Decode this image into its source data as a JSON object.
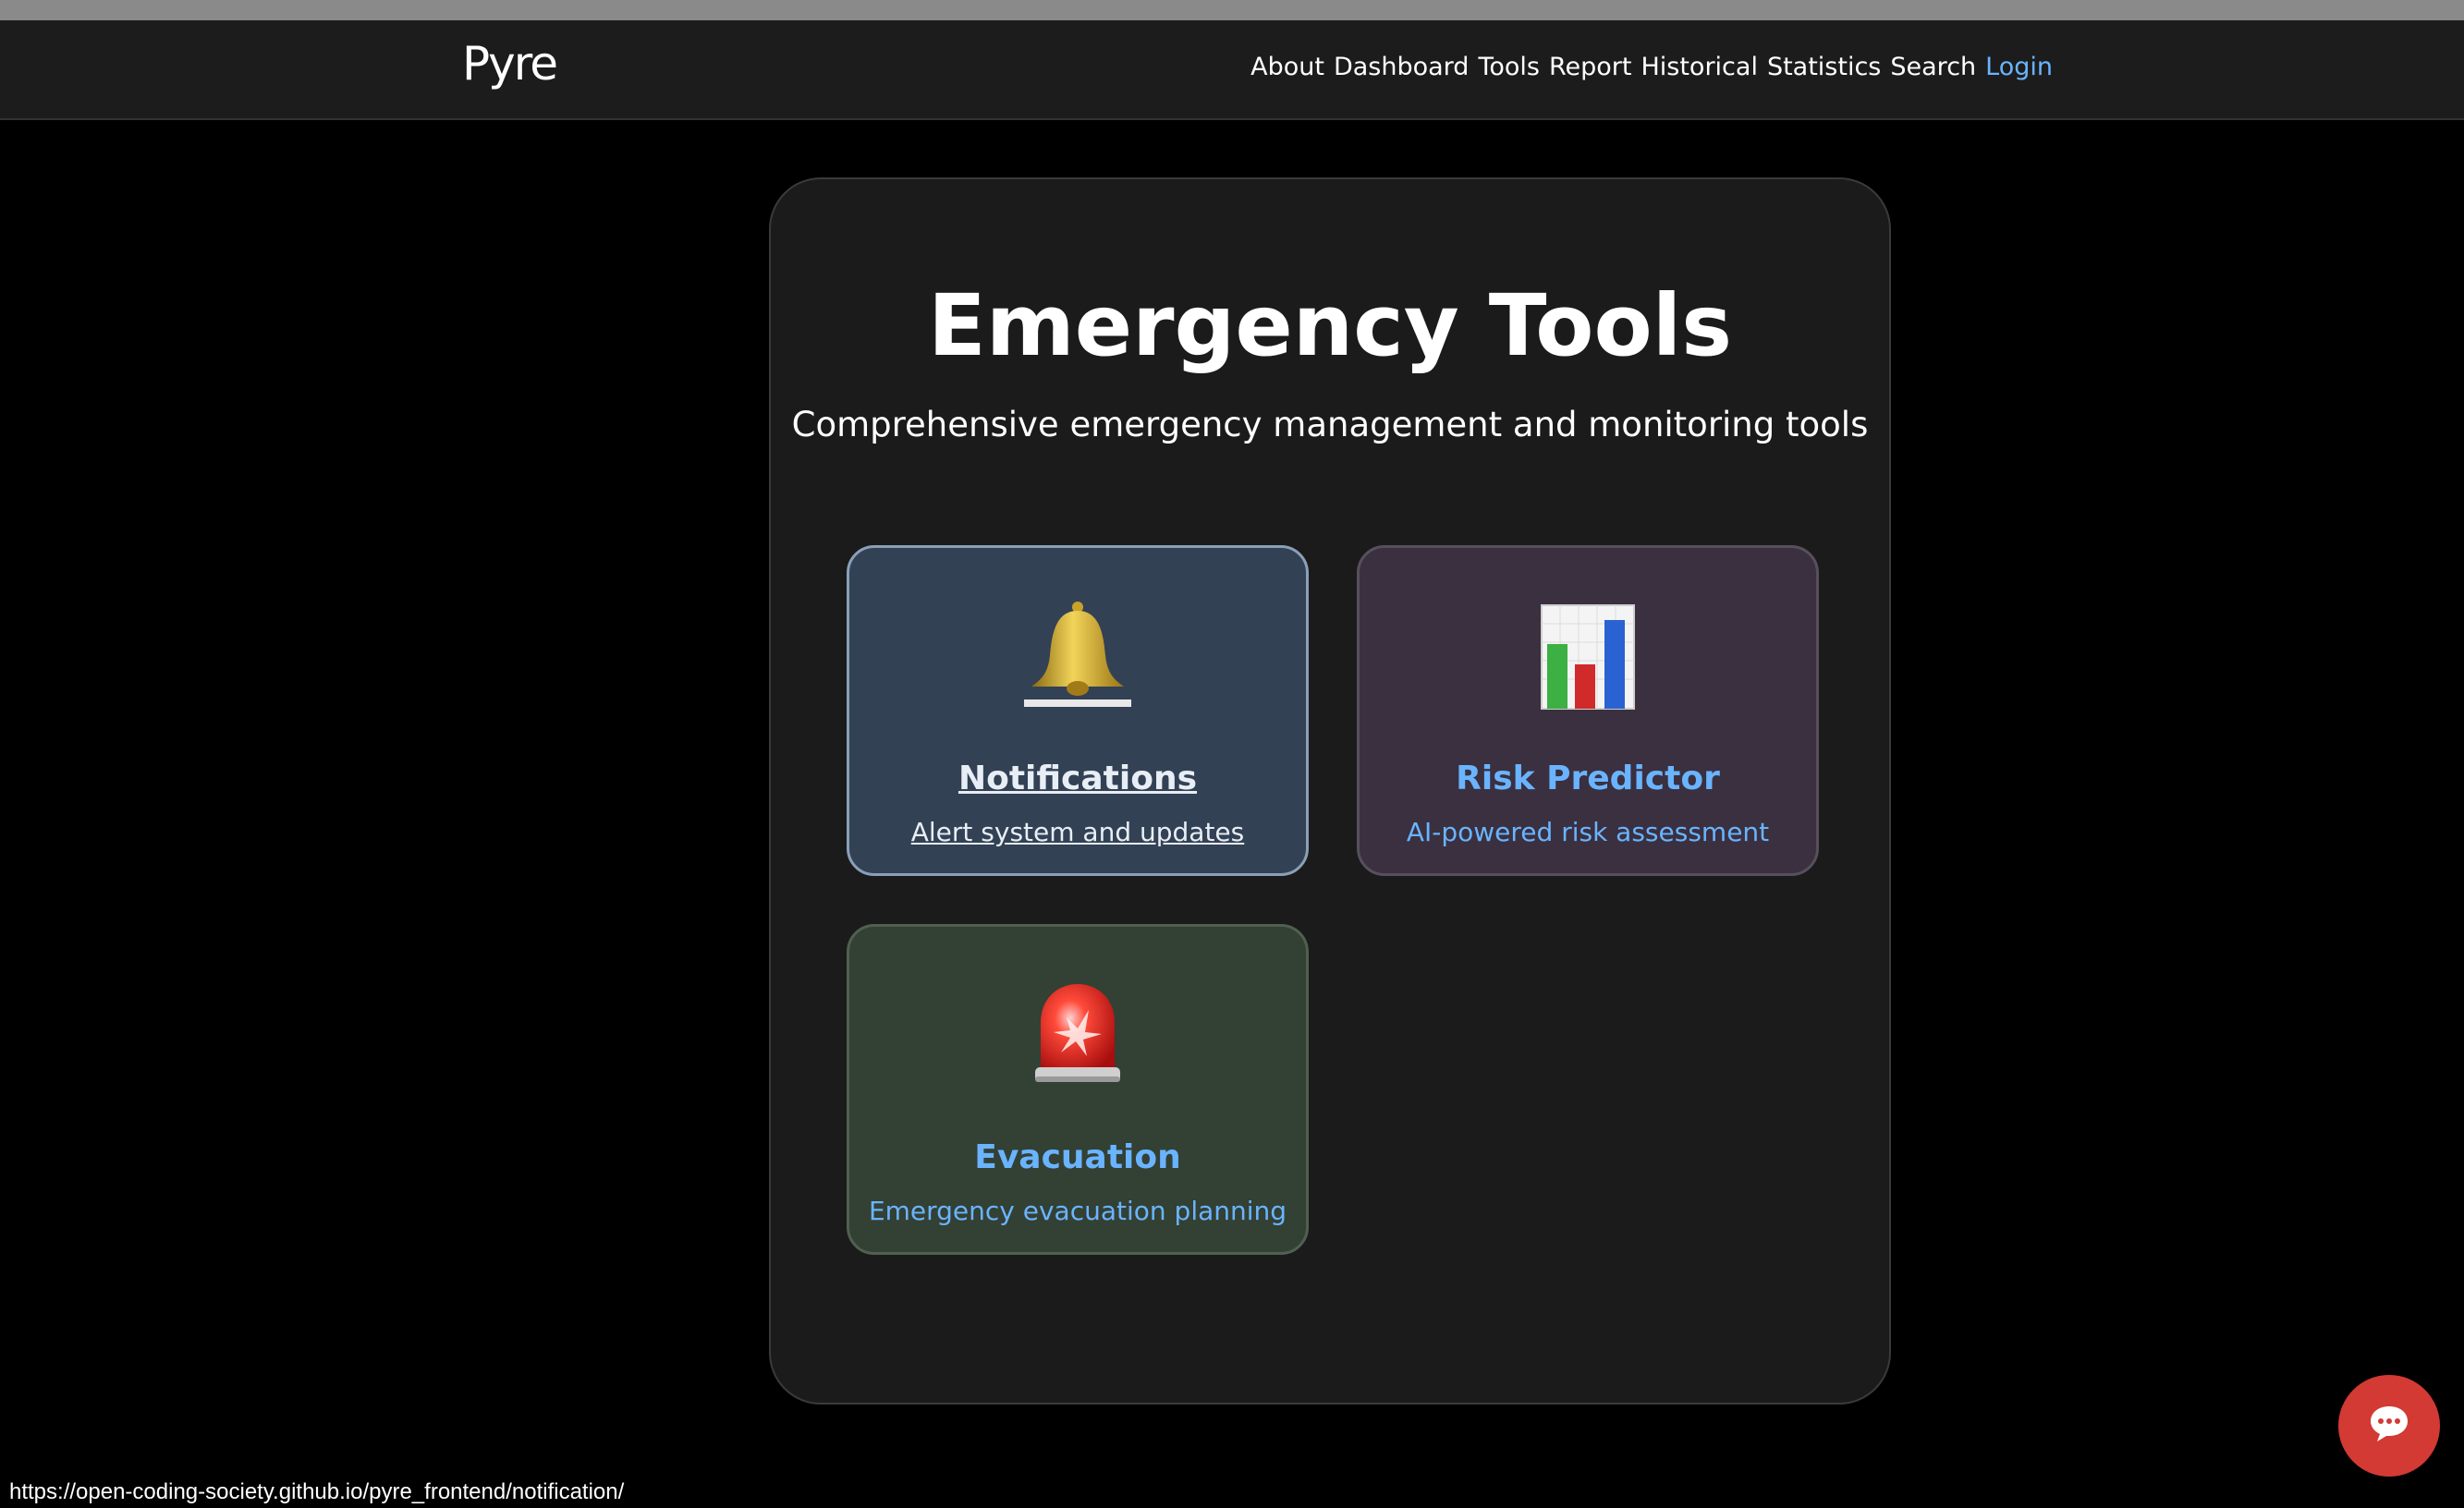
{
  "navbar": {
    "brand": "Pyre",
    "links": [
      "About",
      "Dashboard",
      "Tools",
      "Report",
      "Historical",
      "Statistics",
      "Search"
    ],
    "login": "Login"
  },
  "main": {
    "title": "Emergency Tools",
    "subtitle": "Comprehensive emergency management and monitoring tools",
    "cards": [
      {
        "icon": "bell-icon",
        "title": "Notifications",
        "description": "Alert system and updates"
      },
      {
        "icon": "bar-chart-icon",
        "title": "Risk Predictor",
        "description": "AI-powered risk assessment"
      },
      {
        "icon": "siren-icon",
        "title": "Evacuation",
        "description": "Emergency evacuation planning"
      }
    ]
  },
  "status_bar": {
    "url": "https://open-coding-society.github.io/pyre_frontend/notification/"
  },
  "chat": {
    "icon": "chat-bubble-icon"
  },
  "colors": {
    "accent": "#6ab4ff",
    "chat_button": "#d33a34",
    "background": "#000000",
    "panel": "#1b1b1b"
  }
}
